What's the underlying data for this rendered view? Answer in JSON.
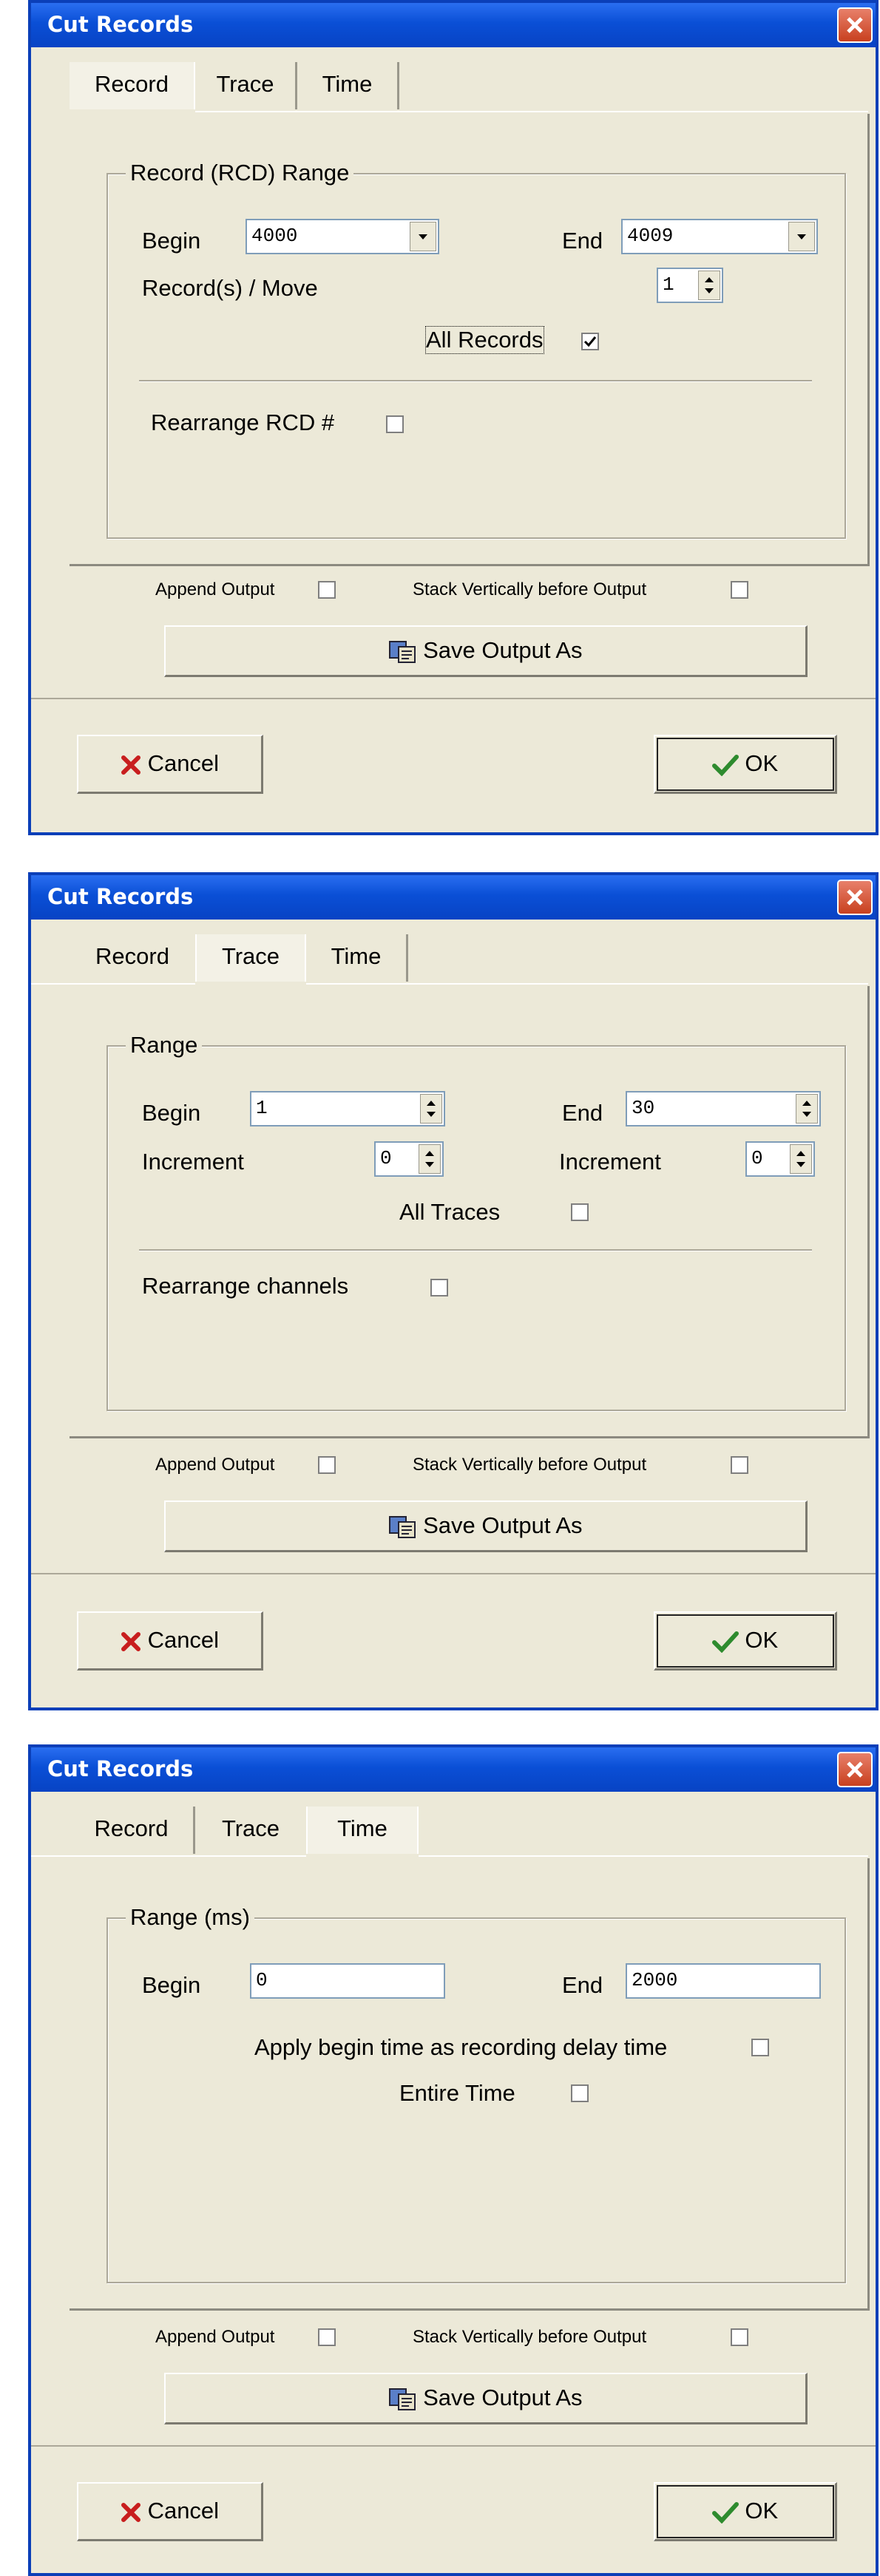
{
  "dialogs": [
    {
      "title": "Cut Records",
      "tabs": [
        "Record",
        "Trace",
        "Time"
      ],
      "active_tab": "Record",
      "group_title": "Record (RCD) Range",
      "begin_label": "Begin",
      "begin_value": "4000",
      "end_label": "End",
      "end_value": "4009",
      "move_label": "Record(s) / Move",
      "move_value": "1",
      "all_label": "All Records",
      "all_checked": true,
      "rearrange_label": "Rearrange RCD #",
      "append_label": "Append Output",
      "stack_label": "Stack Vertically before Output",
      "save_label": "Save Output As",
      "cancel_label": "Cancel",
      "ok_label": "OK"
    },
    {
      "title": "Cut Records",
      "tabs": [
        "Record",
        "Trace",
        "Time"
      ],
      "active_tab": "Trace",
      "group_title": "Range",
      "begin_label": "Begin",
      "begin_value": "1",
      "end_label": "End",
      "end_value": "30",
      "increment_label": "Increment",
      "increment_value": "0",
      "increment2_label": "Increment",
      "increment2_value": "0",
      "all_label": "All Traces",
      "rearrange_label": "Rearrange channels",
      "append_label": "Append Output",
      "stack_label": "Stack Vertically before Output",
      "save_label": "Save Output As",
      "cancel_label": "Cancel",
      "ok_label": "OK"
    },
    {
      "title": "Cut Records",
      "tabs": [
        "Record",
        "Trace",
        "Time"
      ],
      "active_tab": "Time",
      "group_title": "Range (ms)",
      "begin_label": "Begin",
      "begin_value": "0",
      "end_label": "End",
      "end_value": "2000",
      "delay_label": "Apply begin time as recording delay time",
      "entire_label": "Entire Time",
      "append_label": "Append Output",
      "stack_label": "Stack Vertically before Output",
      "save_label": "Save Output As",
      "cancel_label": "Cancel",
      "ok_label": "OK"
    }
  ],
  "colors": {
    "titlebar": "#0a4fd6",
    "dialog_bg": "#ece9d8",
    "close": "#c8401f",
    "ok_check": "#2e8b2e",
    "cancel_x": "#c81e1e"
  },
  "icons": [
    "close-icon",
    "dropdown-arrow-icon",
    "spinner-icon",
    "checkbox-icon",
    "save-icon",
    "cancel-x-icon",
    "ok-check-icon"
  ]
}
